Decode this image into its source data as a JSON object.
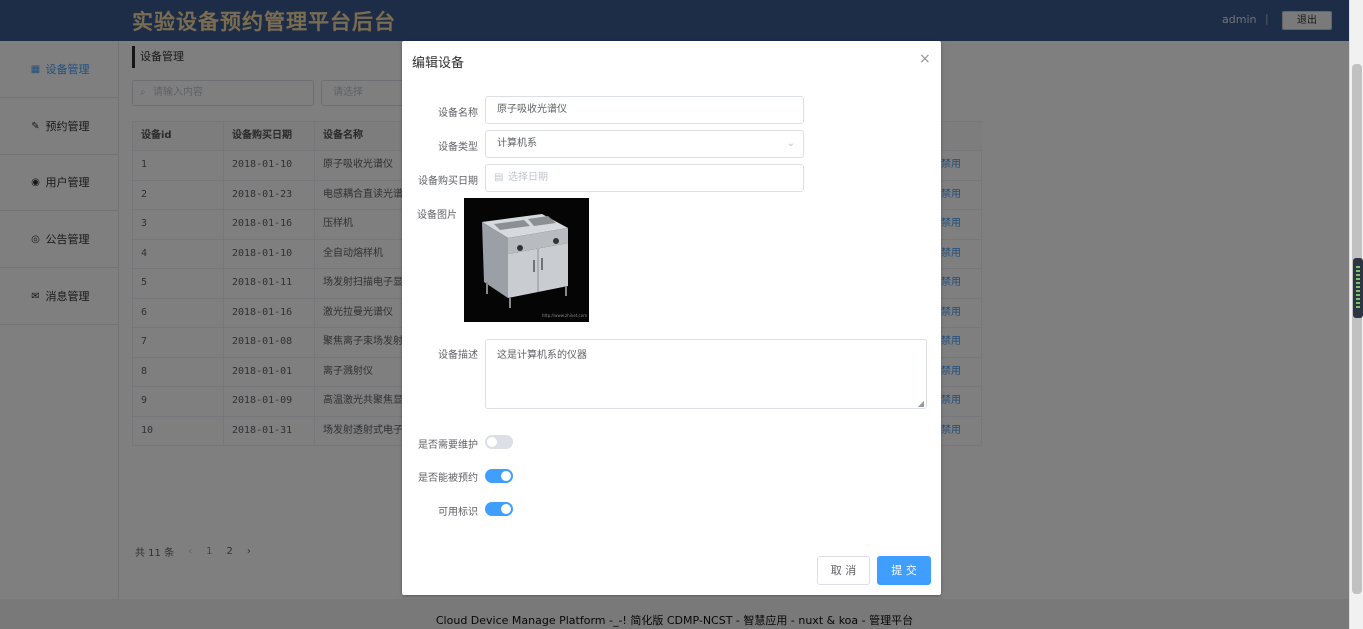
{
  "header": {
    "title": "实验设备预约管理平台后台",
    "user": "admin",
    "separator": "|",
    "logout": "退出"
  },
  "sidebar": {
    "items": [
      {
        "label": "设备管理",
        "icon": "grid-icon",
        "glyph": "▦"
      },
      {
        "label": "预约管理",
        "icon": "edit-icon",
        "glyph": "✎"
      },
      {
        "label": "用户管理",
        "icon": "user-icon",
        "glyph": "◉"
      },
      {
        "label": "公告管理",
        "icon": "eye-icon",
        "glyph": "◎"
      },
      {
        "label": "消息管理",
        "icon": "mail-icon",
        "glyph": "✉"
      }
    ]
  },
  "main": {
    "breadcrumb": "设备管理",
    "search_placeholder": "请输入内容",
    "select_placeholder": "请选择",
    "table": {
      "headers": [
        "设备id",
        "设备购买日期",
        "设备名称"
      ],
      "action_label": "禁用",
      "rows": [
        [
          "1",
          "2018-01-10",
          "原子吸收光谱仪"
        ],
        [
          "2",
          "2018-01-23",
          "电感耦合直读光谱仪"
        ],
        [
          "3",
          "2018-01-16",
          "压样机"
        ],
        [
          "4",
          "2018-01-10",
          "全自动熔样机"
        ],
        [
          "5",
          "2018-01-11",
          "场发射扫描电子显微镜"
        ],
        [
          "6",
          "2018-01-16",
          "激光拉曼光谱仪"
        ],
        [
          "7",
          "2018-01-08",
          "聚焦离子束场发射显微镜"
        ],
        [
          "8",
          "2018-01-01",
          "离子溅射仪"
        ],
        [
          "9",
          "2018-01-09",
          "高温激光共聚焦显微镜"
        ],
        [
          "10",
          "2018-01-31",
          "场发射透射式电子显微镜"
        ]
      ]
    },
    "pager": {
      "total": "共 11 条",
      "prev": "‹",
      "pages": [
        "1",
        "2"
      ],
      "next": "›"
    }
  },
  "footer": "Cloud Device Manage Platform -_-! 简化版 CDMP-NCST - 智慧应用 - nuxt & koa - 管理平台",
  "dialog": {
    "title": "编辑设备",
    "close": "×",
    "fields": {
      "name_label": "设备名称",
      "name_value": "原子吸收光谱仪",
      "type_label": "设备类型",
      "type_value": "计算机系",
      "date_label": "设备购买日期",
      "date_placeholder": "选择日期",
      "image_label": "设备图片",
      "image_caption": "http://www.zhinet.com",
      "desc_label": "设备描述",
      "desc_value": "这是计算机系的仪器",
      "maintain_label": "是否需要维护",
      "maintain_on": false,
      "bookable_label": "是否能被预约",
      "bookable_on": true,
      "available_label": "可用标识",
      "available_on": true
    },
    "cancel": "取 消",
    "submit": "提 交"
  },
  "colors": {
    "header_bg": "#3a5a8f",
    "title_color": "#f3d9a2",
    "primary": "#409eff"
  }
}
